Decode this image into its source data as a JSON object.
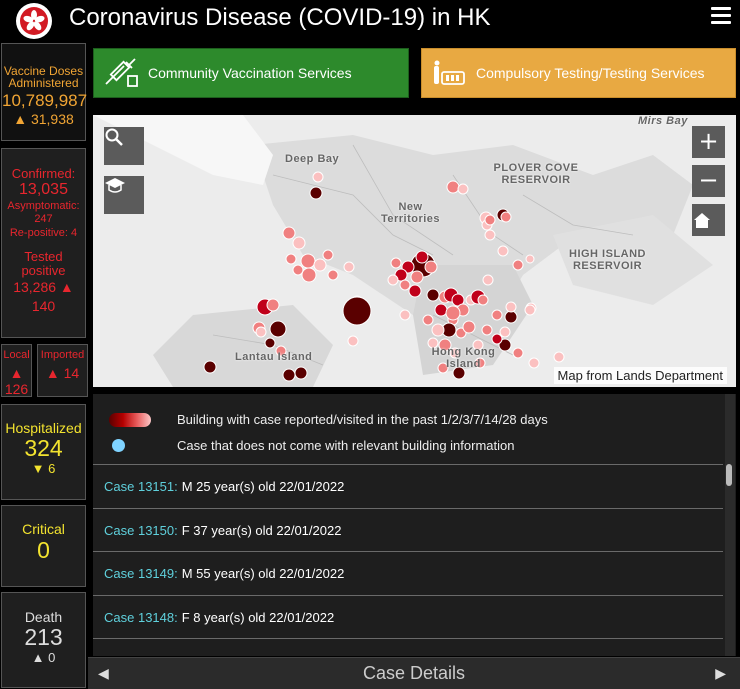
{
  "header": {
    "title": "Coronavirus Disease (COVID-19) in HK",
    "logo": "hk-bauhinia-logo",
    "menu_icon": "hamburger-icon"
  },
  "stats": {
    "vaccine": {
      "label": "Vaccine Doses Administered",
      "value": "10,789,987",
      "delta": "▲ 31,938"
    },
    "confirmed": {
      "label": "Confirmed:",
      "value": "13,035",
      "asym_label": "Asymptomatic:",
      "asym_value": "247",
      "repos": "Re-positive: 4",
      "tested_label": "Tested positive",
      "tested_value": "13,286 ▲ 140"
    },
    "local": {
      "label": "Local",
      "value": "▲ 126"
    },
    "imported": {
      "label": "Imported",
      "value": "▲ 14"
    },
    "hospitalized": {
      "label": "Hospitalized",
      "value": "324",
      "delta": "▼ 6"
    },
    "critical": {
      "label": "Critical",
      "value": "0"
    },
    "death": {
      "label": "Death",
      "value": "213",
      "delta": "▲ 0"
    }
  },
  "services": {
    "vaccination": "Community Vaccination Services",
    "testing": "Compulsory Testing/Testing Services"
  },
  "map": {
    "labels": {
      "deep_bay": "Deep Bay",
      "new_territories": "New Territories",
      "plover_cove": "PLOVER COVE RESERVOIR",
      "high_island": "HIGH ISLAND RESERVOIR",
      "lantau": "Lantau Island",
      "hk_island": "Hong Kong Island",
      "mirs_bay": "Mirs Bay"
    },
    "attribution": "Map from Lands Department",
    "colors": {
      "dark": "#5a0000",
      "mid": "#c0001a",
      "light": "#f08080",
      "pale": "#fbc0c0"
    }
  },
  "legend": {
    "building": "Building with case reported/visited in the past 1/2/3/7/14/28 days",
    "no_building": "Case that does not come with relevant building information"
  },
  "cases": [
    {
      "id": "Case 13151:",
      "info": "M  25 year(s) old  22/01/2022"
    },
    {
      "id": "Case 13150:",
      "info": "F  37 year(s) old  22/01/2022"
    },
    {
      "id": "Case 13149:",
      "info": "M  55 year(s) old  22/01/2022"
    },
    {
      "id": "Case 13148:",
      "info": "F  8 year(s) old  22/01/2022"
    }
  ],
  "bottom": {
    "title": "Case Details",
    "left": "◀",
    "right": "▶"
  }
}
